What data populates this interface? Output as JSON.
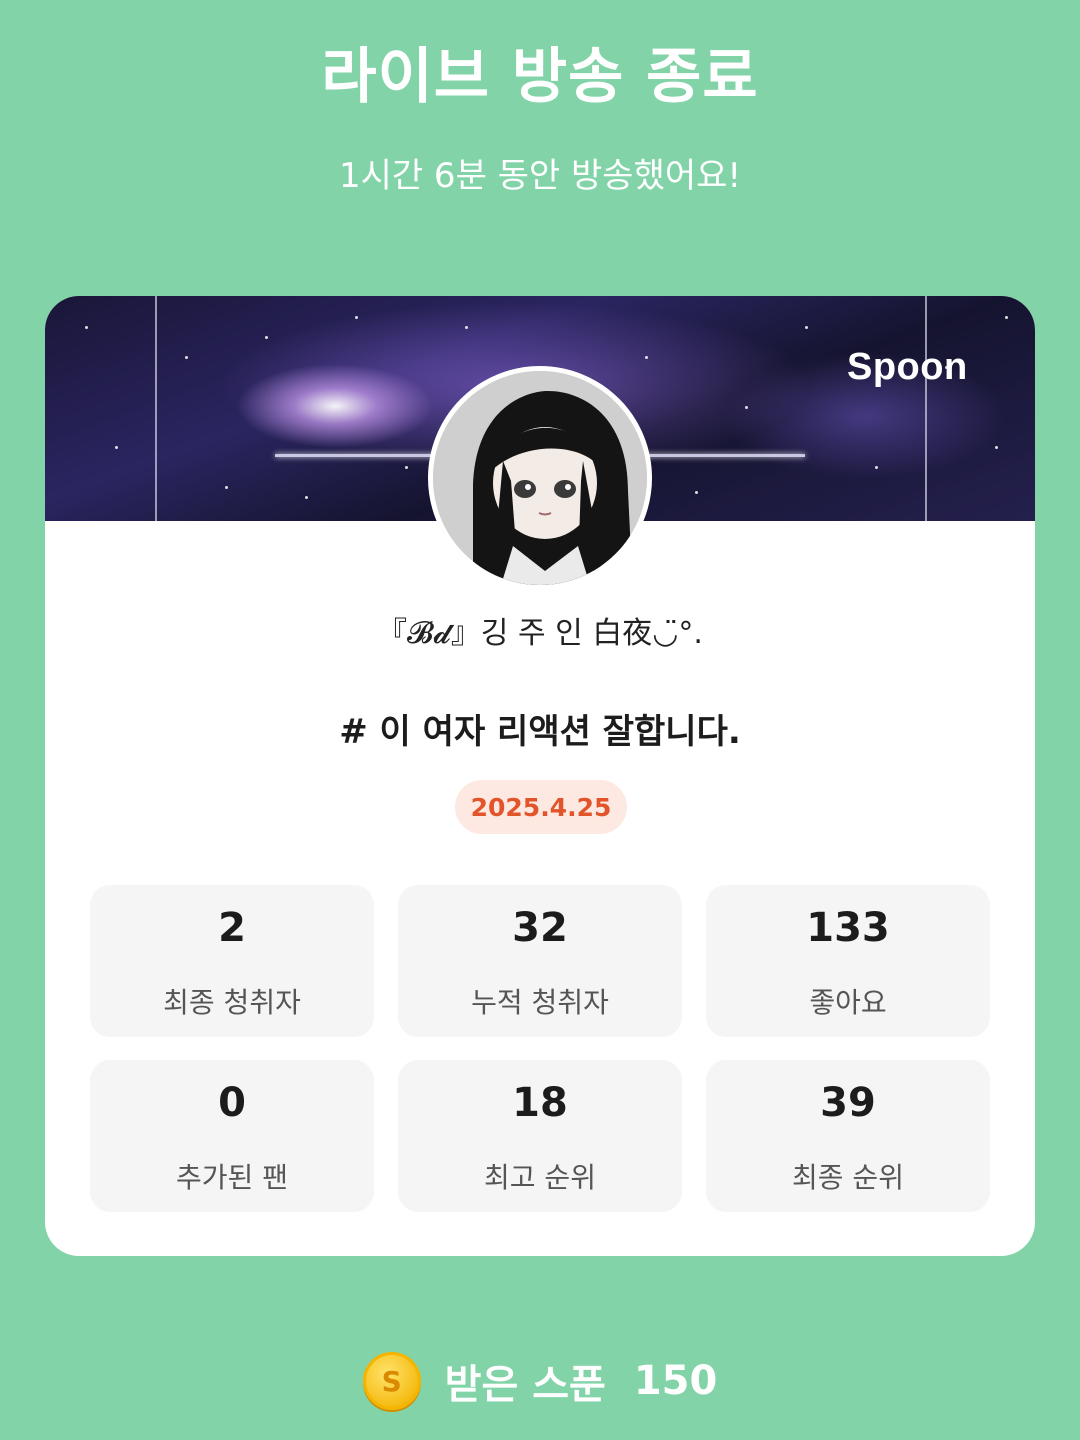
{
  "header": {
    "title": "라이브 방송 종료",
    "subtitle": "1시간 6분 동안 방송했어요!"
  },
  "card": {
    "brand": "Spoon",
    "nickname": "『𝓑𝓭』깅 주 인 白夜◡̈°.",
    "headline": "# 이 여자 리액션 잘합니다.",
    "date": "2025.4.25",
    "stats": [
      {
        "value": "2",
        "label": "최종 청취자"
      },
      {
        "value": "32",
        "label": "누적 청취자"
      },
      {
        "value": "133",
        "label": "좋아요"
      },
      {
        "value": "0",
        "label": "추가된 팬"
      },
      {
        "value": "18",
        "label": "최고 순위"
      },
      {
        "value": "39",
        "label": "최종 순위"
      }
    ]
  },
  "footer": {
    "coin_symbol": "S",
    "label": "받은 스푼",
    "value": "150"
  },
  "colors": {
    "background": "#82d4a8",
    "date_text": "#e2552b",
    "date_bg": "#fde9e2",
    "coin": "#f5bd16"
  }
}
